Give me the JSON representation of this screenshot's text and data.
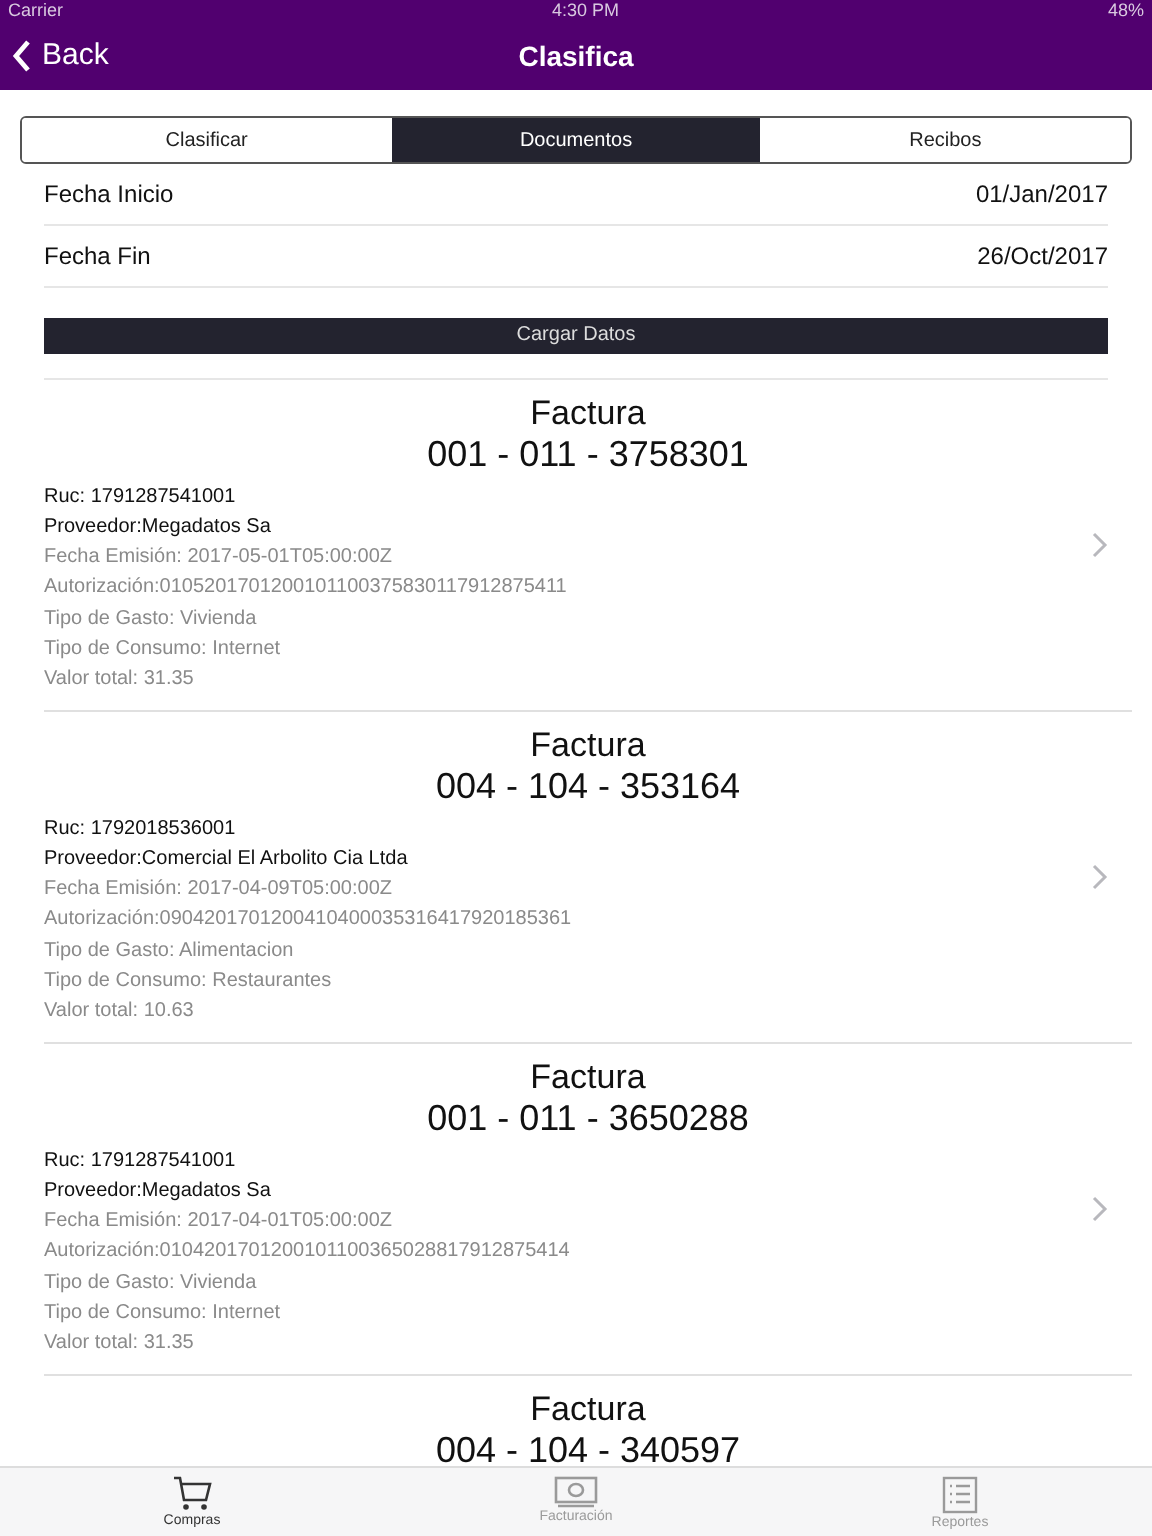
{
  "status_bar": {
    "carrier": "Carrier",
    "time": "4:30 PM",
    "battery": "48%"
  },
  "nav": {
    "back": "Back",
    "title": "Clasifica"
  },
  "segments": [
    {
      "label": "Clasificar",
      "selected": false
    },
    {
      "label": "Documentos",
      "selected": true
    },
    {
      "label": "Recibos",
      "selected": false
    }
  ],
  "dates": [
    {
      "label": "Fecha Inicio",
      "value": "01/Jan/2017"
    },
    {
      "label": "Fecha Fin",
      "value": "26/Oct/2017"
    }
  ],
  "load_button": "Cargar Datos",
  "documents": [
    {
      "type": "Factura",
      "number": "001 - 011 - 3758301",
      "lines": [
        {
          "text": "Ruc: 1791287541001",
          "kind": "primary"
        },
        {
          "text": "Proveedor:Megadatos Sa",
          "kind": "primary"
        },
        {
          "text": "Fecha Emisión: 2017-05-01T05:00:00Z",
          "kind": "secondary"
        },
        {
          "text": "Autorización:0105201701200101100375830117912875411",
          "kind": "secondary"
        },
        {
          "text": "Tipo de Gasto: Vivienda",
          "kind": "secondary"
        },
        {
          "text": "Tipo de Consumo: Internet",
          "kind": "secondary"
        },
        {
          "text": "Valor total: 31.35",
          "kind": "secondary"
        }
      ]
    },
    {
      "type": "Factura",
      "number": "004 - 104 - 353164",
      "lines": [
        {
          "text": "Ruc: 1792018536001",
          "kind": "primary"
        },
        {
          "text": "Proveedor:Comercial El Arbolito Cia Ltda",
          "kind": "primary"
        },
        {
          "text": "Fecha Emisión: 2017-04-09T05:00:00Z",
          "kind": "secondary"
        },
        {
          "text": "Autorización:0904201701200410400035316417920185361",
          "kind": "secondary"
        },
        {
          "text": "Tipo de Gasto: Alimentacion",
          "kind": "secondary"
        },
        {
          "text": "Tipo de Consumo: Restaurantes",
          "kind": "secondary"
        },
        {
          "text": "Valor total: 10.63",
          "kind": "secondary"
        }
      ]
    },
    {
      "type": "Factura",
      "number": "001 - 011 - 3650288",
      "lines": [
        {
          "text": "Ruc: 1791287541001",
          "kind": "primary"
        },
        {
          "text": "Proveedor:Megadatos Sa",
          "kind": "primary"
        },
        {
          "text": "Fecha Emisión: 2017-04-01T05:00:00Z",
          "kind": "secondary"
        },
        {
          "text": "Autorización:0104201701200101100365028817912875414",
          "kind": "secondary"
        },
        {
          "text": "Tipo de Gasto: Vivienda",
          "kind": "secondary"
        },
        {
          "text": "Tipo de Consumo: Internet",
          "kind": "secondary"
        },
        {
          "text": "Valor total: 31.35",
          "kind": "secondary"
        }
      ]
    },
    {
      "type": "Factura",
      "number": "004 - 104 - 340597"
    }
  ],
  "tab_bar": [
    {
      "label": "Compras",
      "kind": "cart",
      "selected": true
    },
    {
      "label": "Facturación",
      "kind": "money",
      "selected": false
    },
    {
      "label": "Reportes",
      "kind": "list",
      "selected": false
    }
  ]
}
